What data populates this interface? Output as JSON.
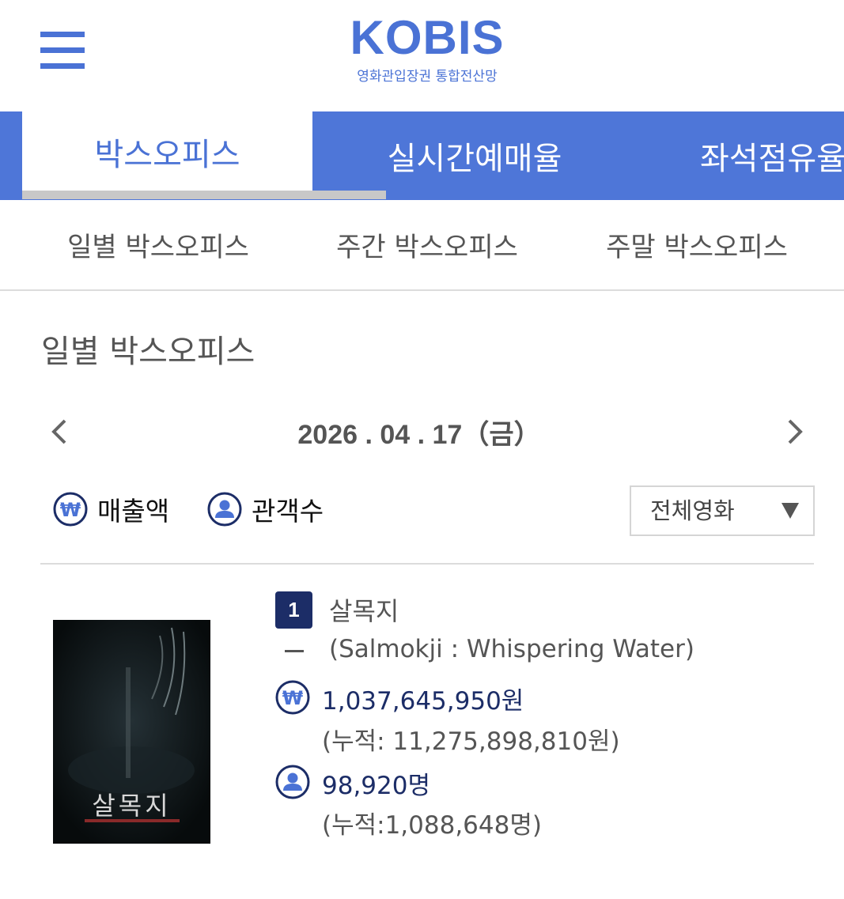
{
  "header": {
    "logo_title": "KOBIS",
    "logo_subtitle": "영화관입장권 통합전산망",
    "menu_icon": "hamburger-menu-icon",
    "brand_color": "#4a72d5"
  },
  "tabs": [
    {
      "label": "박스오피스",
      "active": true
    },
    {
      "label": "실시간예매율",
      "active": false
    },
    {
      "label": "좌석점유율",
      "active": false
    }
  ],
  "subtabs": [
    {
      "label": "일별 박스오피스"
    },
    {
      "label": "주간 박스오피스"
    },
    {
      "label": "주말 박스오피스"
    }
  ],
  "section": {
    "title": "일별 박스오피스",
    "date": "2026 . 04 . 17（금）"
  },
  "toggles": {
    "sales_label": "매출액",
    "sales_icon": "won-icon",
    "audience_label": "관객수",
    "audience_icon": "person-icon"
  },
  "filter": {
    "selected": "전체영화"
  },
  "movies": [
    {
      "rank": "1",
      "rank_change": "–",
      "title": "살목지",
      "title_en": "(Salmokji : Whispering Water)",
      "poster_title": "살목지",
      "sales": "1,037,645,950원",
      "sales_cumulative": "(누적: 11,275,898,810원)",
      "audience": "98,920명",
      "audience_cumulative": "(누적:1,088,648명)"
    }
  ],
  "colors": {
    "accent": "#4e76d8",
    "rank_badge": "#1c2d67",
    "stat_text": "#1c2d67"
  }
}
